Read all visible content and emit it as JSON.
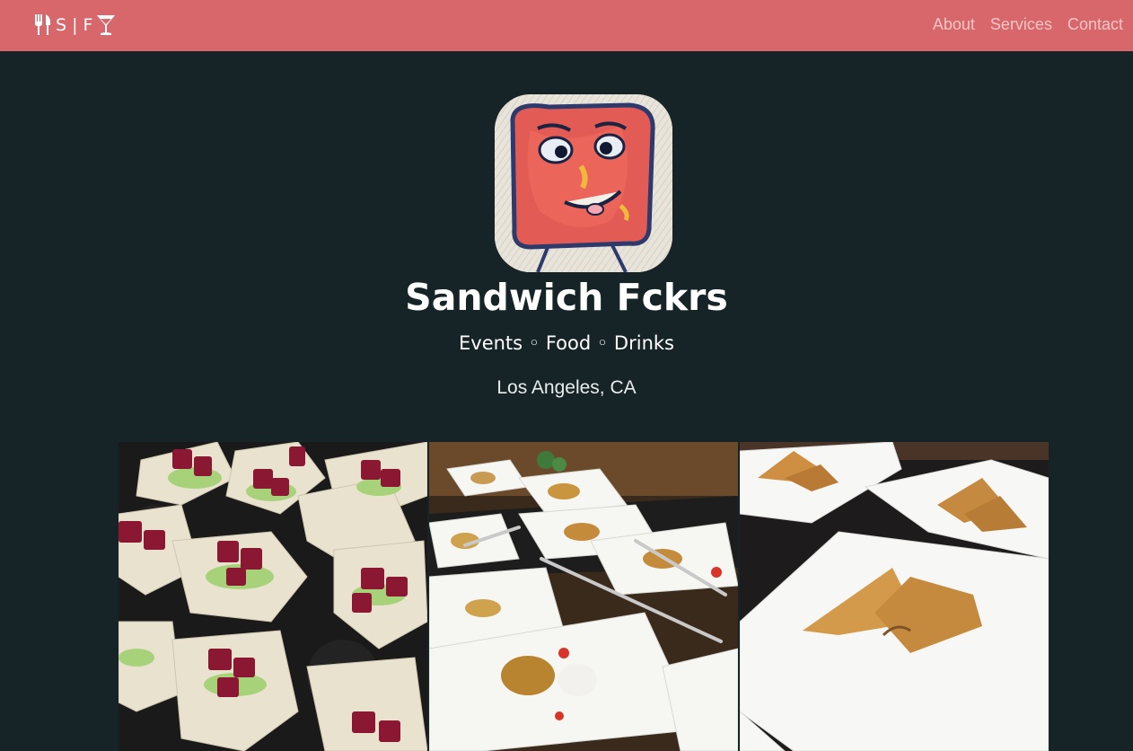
{
  "navbar": {
    "brand_text": "S | F",
    "brand_left_icon": "fork-knife-icon",
    "brand_right_icon": "cocktail-glass-icon",
    "links": [
      {
        "label": "About"
      },
      {
        "label": "Services"
      },
      {
        "label": "Contact"
      }
    ],
    "background": "#d7676a"
  },
  "hero": {
    "title": "Sandwich Fckrs",
    "tagline": "Events ◦ Food ◦ Drinks",
    "location": "Los Angeles, CA",
    "background": "#172427"
  },
  "gallery": {
    "photos": [
      {
        "subject": "beet-tartare-on-crackers"
      },
      {
        "subject": "plated-fried-dish-with-forks"
      },
      {
        "subject": "samosas-on-white-plates"
      }
    ]
  }
}
